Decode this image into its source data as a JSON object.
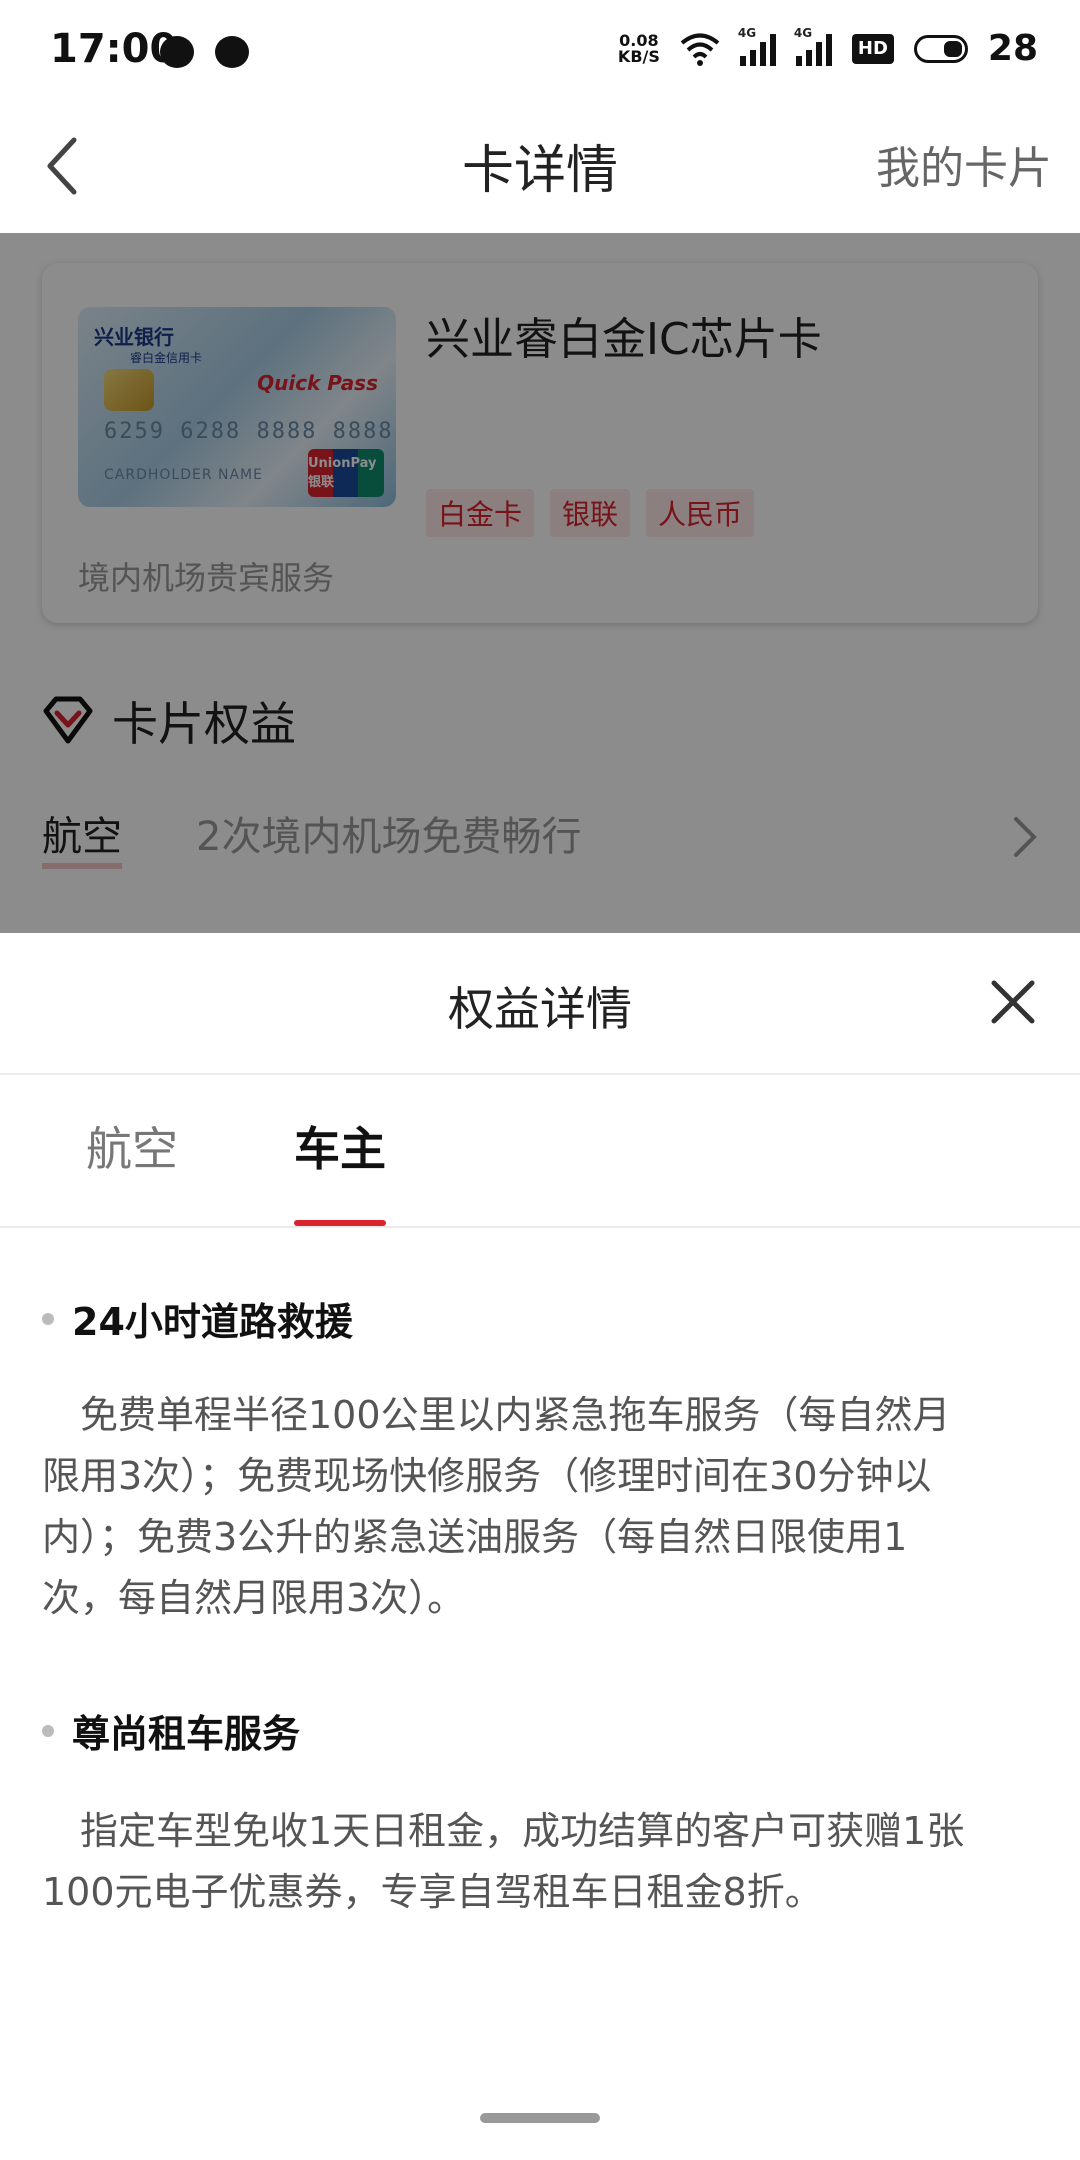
{
  "status_bar": {
    "time": "17:00",
    "net_speed_value": "0.08",
    "net_speed_unit": "KB/S",
    "signal1_label": "4G",
    "signal2_label": "4G",
    "hd_label": "HD",
    "battery": "28",
    "icons": [
      "wechat-bubble-icon",
      "message-bubble-icon",
      "wifi-icon",
      "signal-icon",
      "hd-icon",
      "battery-icon"
    ]
  },
  "header": {
    "title": "卡详情",
    "right_link": "我的卡片"
  },
  "card": {
    "name": "兴业睿白金IC芯片卡",
    "bank_name": "兴业银行",
    "bank_sub": "睿白金信用卡",
    "number": "6259 6288 8888 8888",
    "holder": "CARDHOLDER NAME",
    "quickpass": "Quick Pass",
    "unionpay": "UnionPay 银联",
    "tags": [
      "白金卡",
      "银联",
      "人民币"
    ],
    "description": "境内机场贵宾服务"
  },
  "benefits": {
    "heading": "卡片权益",
    "row": {
      "category": "航空",
      "text": "2次境内机场免费畅行"
    }
  },
  "sheet": {
    "title": "权益详情",
    "tabs": [
      {
        "label": "航空",
        "active": false
      },
      {
        "label": "车主",
        "active": true
      }
    ],
    "sections": [
      {
        "title": "24小时道路救援",
        "lines": [
          "免费单程半径100公里以内紧急拖车服务（每自然月",
          "限用3次）；免费现场快修服务（修理时间在30分钟以",
          "内）；免费3公升的紧急送油服务（每自然日限使用1",
          "次，每自然月限用3次）。"
        ]
      },
      {
        "title": "尊尚租车服务",
        "lines": [
          "指定车型免收1天日租金，成功结算的客户可获赠1张",
          "100元电子优惠券，专享自驾租车日租金8折。"
        ]
      }
    ]
  },
  "colors": {
    "accent": "#d9232e",
    "tag_bg": "#fde7e7",
    "overlay": "rgba(0,0,0,0.45)"
  }
}
